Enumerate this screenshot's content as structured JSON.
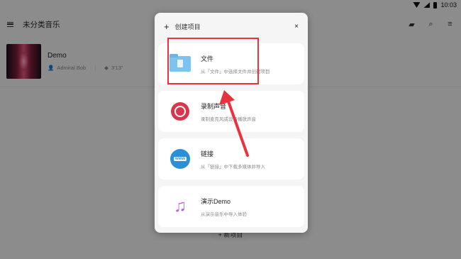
{
  "statusbar": {
    "time": "10:03"
  },
  "app": {
    "title": "未分类音乐",
    "song": {
      "title": "Demo",
      "artist": "Admiral Bob",
      "duration": "3'13\""
    },
    "new_button": "新项目"
  },
  "dialog": {
    "title": "创建项目",
    "close_icon": "×",
    "options": [
      {
        "title": "文件",
        "desc": "从「文件」中选择文件并创建项目",
        "icon": "folder-icon"
      },
      {
        "title": "录制声音",
        "desc": "录制麦克风或设备播放声音",
        "icon": "record-icon"
      },
      {
        "title": "链接",
        "desc": "从「链接」中下载多媒体并导入",
        "icon": "globe-icon"
      },
      {
        "title": "演示Demo",
        "desc": "从演示音乐中导入体验",
        "icon": "music-note-icon"
      }
    ]
  },
  "glyphs": {
    "globe_text": "www",
    "plus": "+",
    "note": "♫"
  },
  "colors": {
    "highlight": "#e8333e",
    "record": "#d8364c",
    "globe": "#2b8fd6",
    "folder": "#7cc3f0"
  }
}
